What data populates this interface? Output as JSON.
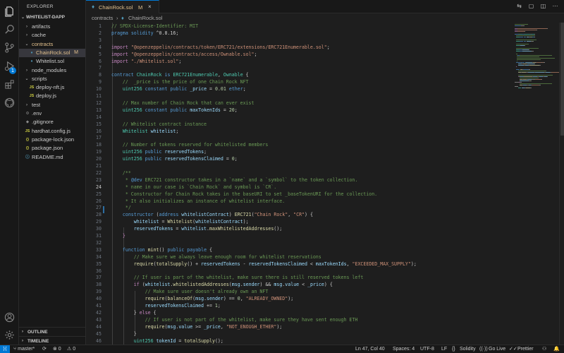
{
  "sidebar": {
    "title": "EXPLORER",
    "root": "WHITELIST-DAPP",
    "tree": [
      {
        "label": "artifacts",
        "chev": "›",
        "indent": 1
      },
      {
        "label": "cache",
        "chev": "›",
        "indent": 1
      },
      {
        "label": "contracts",
        "chev": "⌄",
        "indent": 1,
        "color": "orange"
      },
      {
        "label": "ChainRock.sol",
        "icon": "♦",
        "indent": 2,
        "color": "orange",
        "mod": "M",
        "selected": true
      },
      {
        "label": "Whitelist.sol",
        "icon": "♦",
        "indent": 2
      },
      {
        "label": "node_modules",
        "chev": "›",
        "indent": 1
      },
      {
        "label": "scripts",
        "chev": "⌄",
        "indent": 1
      },
      {
        "label": "deploy-nft.js",
        "icon": "JS",
        "indent": 2,
        "iconColor": "yellow"
      },
      {
        "label": "deploy.js",
        "icon": "JS",
        "indent": 2,
        "iconColor": "yellow"
      },
      {
        "label": "test",
        "chev": "›",
        "indent": 1
      },
      {
        "label": ".env",
        "icon": "⚙",
        "indent": 1,
        "iconColor": "gray"
      },
      {
        "label": ".gitignore",
        "icon": "◆",
        "indent": 1,
        "iconColor": "gray"
      },
      {
        "label": "hardhat.config.js",
        "icon": "JS",
        "indent": 1,
        "iconColor": "yellow"
      },
      {
        "label": "package-lock.json",
        "icon": "{}",
        "indent": 1,
        "iconColor": "yellow"
      },
      {
        "label": "package.json",
        "icon": "{}",
        "indent": 1,
        "iconColor": "yellow"
      },
      {
        "label": "README.md",
        "icon": "ⓘ",
        "indent": 1,
        "iconColor": "blue"
      }
    ],
    "outline": "OUTLINE",
    "timeline": "TIMELINE"
  },
  "tab": {
    "label": "ChainRock.sol",
    "modified": "M",
    "close": "×"
  },
  "breadcrumb": {
    "folder": "contracts",
    "separator": "›",
    "file": "ChainRock.sol"
  },
  "editor": {
    "active_line": 24,
    "lines": [
      {
        "n": "1",
        "tokens": [
          [
            "cmt",
            "// SPDX-License-Identifier: MIT"
          ]
        ]
      },
      {
        "n": "2",
        "tokens": [
          [
            "kw",
            "pragma"
          ],
          [
            "",
            " "
          ],
          [
            "kw",
            "solidity"
          ],
          [
            "",
            " ^0.8.16;"
          ]
        ]
      },
      {
        "n": "3",
        "tokens": []
      },
      {
        "n": "4",
        "tokens": [
          [
            "ctrl",
            "import"
          ],
          [
            "",
            " "
          ],
          [
            "str",
            "\"@openzeppelin/contracts/token/ERC721/extensions/ERC721Enumerable.sol\""
          ],
          [
            "",
            ";"
          ]
        ]
      },
      {
        "n": "5",
        "tokens": [
          [
            "ctrl",
            "import"
          ],
          [
            "",
            " "
          ],
          [
            "str",
            "\"@openzeppelin/contracts/access/Ownable.sol\""
          ],
          [
            "",
            ";"
          ]
        ]
      },
      {
        "n": "6",
        "tokens": [
          [
            "ctrl",
            "import"
          ],
          [
            "",
            " "
          ],
          [
            "str",
            "\"./Whitelist.sol\""
          ],
          [
            "",
            ";"
          ]
        ]
      },
      {
        "n": "7",
        "tokens": []
      },
      {
        "n": "8",
        "tokens": [
          [
            "kw",
            "contract"
          ],
          [
            "",
            " "
          ],
          [
            "type",
            "ChainRock"
          ],
          [
            "",
            " "
          ],
          [
            "kw",
            "is"
          ],
          [
            "",
            " "
          ],
          [
            "type",
            "ERC721Enumerable"
          ],
          [
            "",
            ", "
          ],
          [
            "type",
            "Ownable"
          ],
          [
            "",
            " {"
          ]
        ]
      },
      {
        "n": "9",
        "tokens": [
          [
            "",
            "    "
          ],
          [
            "cmt",
            "//  _price is the price of one Chain Rock NFT"
          ]
        ]
      },
      {
        "n": "10",
        "tokens": [
          [
            "",
            "    "
          ],
          [
            "type",
            "uint256"
          ],
          [
            "",
            " "
          ],
          [
            "kw",
            "constant"
          ],
          [
            "",
            " "
          ],
          [
            "kw",
            "public"
          ],
          [
            "",
            " "
          ],
          [
            "var",
            "_price"
          ],
          [
            "",
            " = "
          ],
          [
            "num",
            "0.01"
          ],
          [
            "",
            " "
          ],
          [
            "kw",
            "ether"
          ],
          [
            "",
            ";"
          ]
        ]
      },
      {
        "n": "11",
        "tokens": []
      },
      {
        "n": "12",
        "tokens": [
          [
            "",
            "    "
          ],
          [
            "cmt",
            "// Max number of Chain Rock that can ever exist"
          ]
        ]
      },
      {
        "n": "13",
        "tokens": [
          [
            "",
            "    "
          ],
          [
            "type",
            "uint256"
          ],
          [
            "",
            " "
          ],
          [
            "kw",
            "constant"
          ],
          [
            "",
            " "
          ],
          [
            "kw",
            "public"
          ],
          [
            "",
            " "
          ],
          [
            "var",
            "maxTokenIds"
          ],
          [
            "",
            " = "
          ],
          [
            "num",
            "20"
          ],
          [
            "",
            ";"
          ]
        ]
      },
      {
        "n": "14",
        "tokens": []
      },
      {
        "n": "15",
        "tokens": [
          [
            "",
            "    "
          ],
          [
            "cmt",
            "// Whitelist contract instance"
          ]
        ]
      },
      {
        "n": "16",
        "tokens": [
          [
            "",
            "    "
          ],
          [
            "type",
            "Whitelist"
          ],
          [
            "",
            " "
          ],
          [
            "var",
            "whitelist"
          ],
          [
            "",
            ";"
          ]
        ]
      },
      {
        "n": "17",
        "tokens": []
      },
      {
        "n": "18",
        "tokens": [
          [
            "",
            "    "
          ],
          [
            "cmt",
            "// Number of tokens reserved for whitelisted members"
          ]
        ]
      },
      {
        "n": "19",
        "tokens": [
          [
            "",
            "    "
          ],
          [
            "type",
            "uint256"
          ],
          [
            "",
            " "
          ],
          [
            "kw",
            "public"
          ],
          [
            "",
            " "
          ],
          [
            "var",
            "reservedTokens"
          ],
          [
            "",
            ";"
          ]
        ]
      },
      {
        "n": "20",
        "tokens": [
          [
            "",
            "    "
          ],
          [
            "type",
            "uint256"
          ],
          [
            "",
            " "
          ],
          [
            "kw",
            "public"
          ],
          [
            "",
            " "
          ],
          [
            "var",
            "reservedTokensClaimed"
          ],
          [
            "",
            " = "
          ],
          [
            "num",
            "0"
          ],
          [
            "",
            ";"
          ]
        ]
      },
      {
        "n": "21",
        "tokens": []
      },
      {
        "n": "22",
        "tokens": [
          [
            "",
            "    "
          ],
          [
            "cmt",
            "/**"
          ]
        ]
      },
      {
        "n": "23",
        "tokens": [
          [
            "",
            "     "
          ],
          [
            "cmt",
            "* "
          ],
          [
            "doc",
            "@dev"
          ],
          [
            "cmt",
            " ERC721 constructor takes in a `name` and a `symbol` to the token collection."
          ]
        ]
      },
      {
        "n": "24",
        "tokens": [
          [
            "",
            "     "
          ],
          [
            "cmt",
            "* name in our case is `Chain Rock` and symbol is `CR`."
          ]
        ]
      },
      {
        "n": "25",
        "tokens": [
          [
            "",
            "     "
          ],
          [
            "cmt",
            "* Constructor for Chain Rock takes in the baseURI to set _baseTokenURI for the collection."
          ]
        ]
      },
      {
        "n": "26",
        "tokens": [
          [
            "",
            "     "
          ],
          [
            "cmt",
            "* It also initializes an instance of whitelist interface."
          ]
        ]
      },
      {
        "n": "27",
        "tokens": [
          [
            "",
            "     "
          ],
          [
            "cmt",
            "*/"
          ]
        ]
      },
      {
        "n": "28",
        "tokens": [
          [
            "",
            "    "
          ],
          [
            "kw",
            "constructor"
          ],
          [
            "",
            " ("
          ],
          [
            "kw",
            "address"
          ],
          [
            "",
            " "
          ],
          [
            "var",
            "whitelistContract"
          ],
          [
            "",
            ") "
          ],
          [
            "fn",
            "ERC721"
          ],
          [
            "",
            "("
          ],
          [
            "str",
            "\"Chain Rock\""
          ],
          [
            "",
            ", "
          ],
          [
            "str",
            "\"CR\""
          ],
          [
            "",
            ") {"
          ]
        ]
      },
      {
        "n": "29",
        "tokens": [
          [
            "",
            "        "
          ],
          [
            "var",
            "whitelist"
          ],
          [
            "",
            " = "
          ],
          [
            "fn",
            "Whitelist"
          ],
          [
            "",
            "("
          ],
          [
            "var",
            "whitelistContract"
          ],
          [
            "",
            ");"
          ]
        ]
      },
      {
        "n": "30",
        "tokens": [
          [
            "",
            "        "
          ],
          [
            "var",
            "reservedTokens"
          ],
          [
            "",
            " = "
          ],
          [
            "var",
            "whitelist"
          ],
          [
            "",
            "."
          ],
          [
            "fn",
            "maxWhitelistedAddresses"
          ],
          [
            "",
            "();"
          ]
        ]
      },
      {
        "n": "31",
        "tokens": [
          [
            "",
            "    "
          ],
          [
            "ctrl",
            "}"
          ]
        ]
      },
      {
        "n": "32",
        "tokens": []
      },
      {
        "n": "33",
        "tokens": [
          [
            "",
            "    "
          ],
          [
            "kw",
            "function"
          ],
          [
            "",
            " "
          ],
          [
            "fn",
            "mint"
          ],
          [
            "",
            "() "
          ],
          [
            "kw",
            "public"
          ],
          [
            "",
            " "
          ],
          [
            "kw",
            "payable"
          ],
          [
            "",
            " {"
          ]
        ]
      },
      {
        "n": "34",
        "tokens": [
          [
            "",
            "        "
          ],
          [
            "cmt",
            "// Make sure we always leave enough room for whitelist reservations"
          ]
        ]
      },
      {
        "n": "35",
        "tokens": [
          [
            "",
            "        "
          ],
          [
            "fn",
            "require"
          ],
          [
            "",
            "("
          ],
          [
            "fn",
            "totalSupply"
          ],
          [
            "",
            "() + "
          ],
          [
            "var",
            "reservedTokens"
          ],
          [
            "",
            " - "
          ],
          [
            "var",
            "reservedTokensClaimed"
          ],
          [
            "",
            " < "
          ],
          [
            "var",
            "maxTokenIds"
          ],
          [
            "",
            ", "
          ],
          [
            "str",
            "\"EXCEEDED_MAX_SUPPLY\""
          ],
          [
            "",
            ");"
          ]
        ]
      },
      {
        "n": "36",
        "tokens": []
      },
      {
        "n": "37",
        "tokens": [
          [
            "",
            "        "
          ],
          [
            "cmt",
            "// If user is part of the whitelist, make sure there is still reserved tokens left"
          ]
        ]
      },
      {
        "n": "38",
        "tokens": [
          [
            "",
            "        "
          ],
          [
            "ctrl",
            "if"
          ],
          [
            "",
            " ("
          ],
          [
            "var",
            "whitelist"
          ],
          [
            "",
            "."
          ],
          [
            "fn",
            "whitelistedAddresses"
          ],
          [
            "",
            "("
          ],
          [
            "var",
            "msg"
          ],
          [
            "",
            "."
          ],
          [
            "var",
            "sender"
          ],
          [
            "",
            ") && "
          ],
          [
            "var",
            "msg"
          ],
          [
            "",
            "."
          ],
          [
            "var",
            "value"
          ],
          [
            "",
            " < "
          ],
          [
            "var",
            "_price"
          ],
          [
            "",
            ") {"
          ]
        ]
      },
      {
        "n": "39",
        "tokens": [
          [
            "",
            "            "
          ],
          [
            "cmt",
            "// Make sure user doesn't already own an NFT"
          ]
        ]
      },
      {
        "n": "40",
        "tokens": [
          [
            "",
            "            "
          ],
          [
            "fn",
            "require"
          ],
          [
            "",
            "("
          ],
          [
            "fn",
            "balanceOf"
          ],
          [
            "",
            "("
          ],
          [
            "var",
            "msg"
          ],
          [
            "",
            "."
          ],
          [
            "var",
            "sender"
          ],
          [
            "",
            ") == "
          ],
          [
            "num",
            "0"
          ],
          [
            "",
            ", "
          ],
          [
            "str",
            "\"ALREADY_OWNED\""
          ],
          [
            "",
            ");"
          ]
        ]
      },
      {
        "n": "41",
        "tokens": [
          [
            "",
            "            "
          ],
          [
            "var",
            "reservedTokensClaimed"
          ],
          [
            "",
            " += "
          ],
          [
            "num",
            "1"
          ],
          [
            "",
            ";"
          ]
        ]
      },
      {
        "n": "42",
        "tokens": [
          [
            "",
            "        } "
          ],
          [
            "ctrl",
            "else"
          ],
          [
            "",
            " {"
          ]
        ]
      },
      {
        "n": "43",
        "tokens": [
          [
            "",
            "            "
          ],
          [
            "cmt",
            "// If user is not part of the whitelist, make sure they have sent enough ETH"
          ]
        ]
      },
      {
        "n": "44",
        "tokens": [
          [
            "",
            "            "
          ],
          [
            "fn",
            "require"
          ],
          [
            "",
            "("
          ],
          [
            "var",
            "msg"
          ],
          [
            "",
            "."
          ],
          [
            "var",
            "value"
          ],
          [
            "",
            " >= "
          ],
          [
            "var",
            "_price"
          ],
          [
            "",
            ", "
          ],
          [
            "str",
            "\"NOT_ENOUGH_ETHER\""
          ],
          [
            "",
            ");"
          ]
        ]
      },
      {
        "n": "45",
        "tokens": [
          [
            "",
            "        }"
          ]
        ]
      },
      {
        "n": "46",
        "tokens": [
          [
            "",
            "        "
          ],
          [
            "type",
            "uint256"
          ],
          [
            "",
            " "
          ],
          [
            "var",
            "tokenId"
          ],
          [
            "",
            " = "
          ],
          [
            "fn",
            "totalSupply"
          ],
          [
            "",
            "();"
          ]
        ]
      }
    ]
  },
  "status": {
    "branch": "master*",
    "sync": "⟳",
    "errors": "⊗ 0",
    "warnings": "⚠ 0",
    "position": "Ln 47, Col 40",
    "spaces": "Spaces: 4",
    "encoding": "UTF-8",
    "eol": "LF",
    "language": "Solidity",
    "golive": "Go Live",
    "prettier": "Prettier",
    "language_icon": "{}",
    "golive_icon": "((·))",
    "prettier_icon": "✓✓",
    "remote_icon": "⟩⟨",
    "notification_icon": "🔔",
    "account_icon": "⚇"
  },
  "activity": {
    "source_control_badge": "1"
  }
}
